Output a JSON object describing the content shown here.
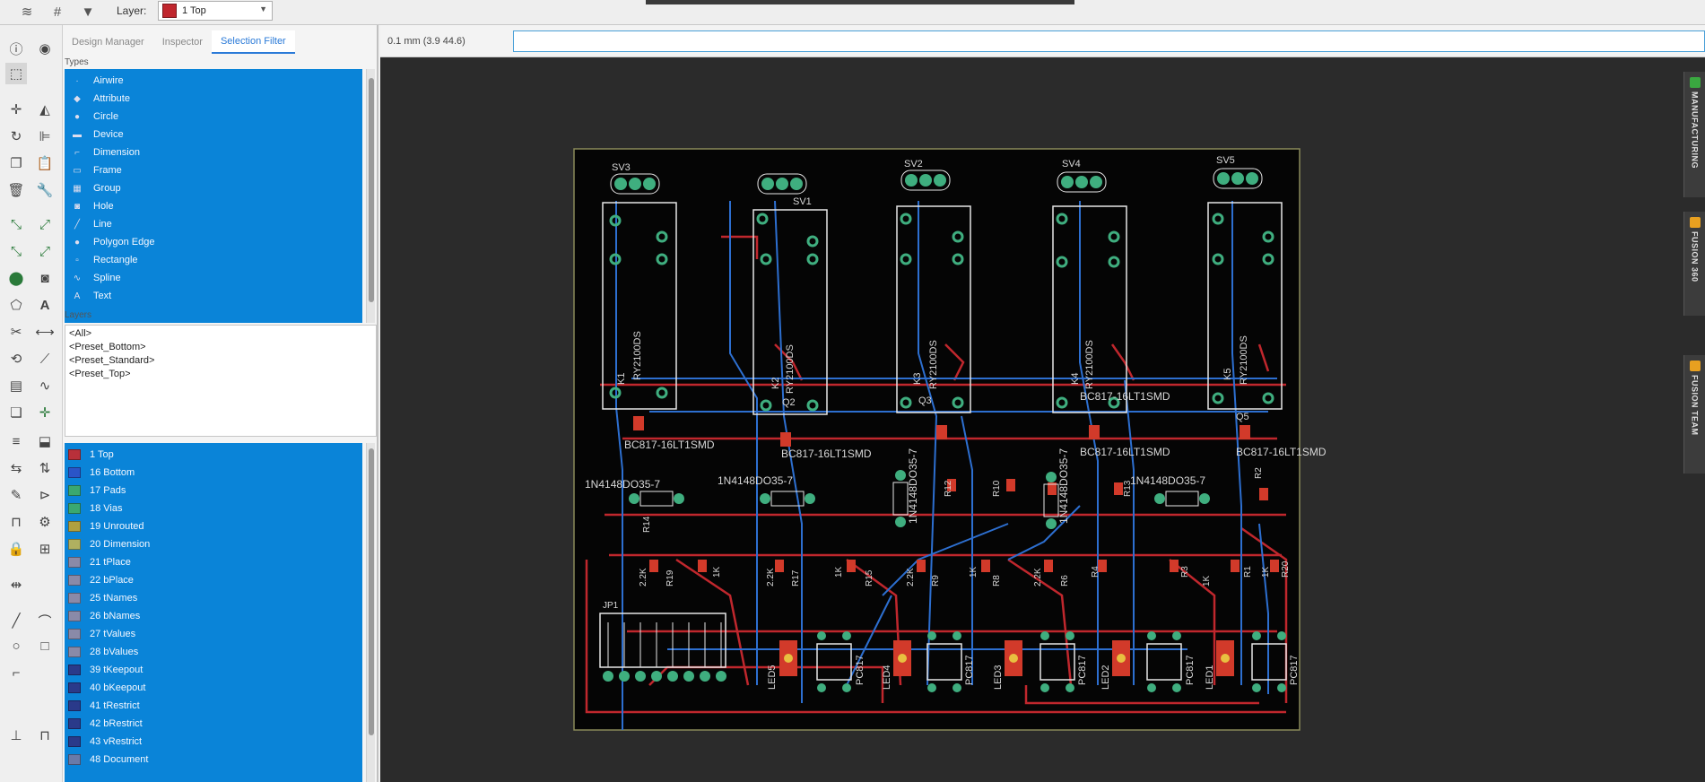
{
  "toolbar": {
    "layer_label": "Layer:",
    "layer_value": "1 Top",
    "layer_color": "#c0262d"
  },
  "panel": {
    "tabs": [
      {
        "label": "Design Manager"
      },
      {
        "label": "Inspector"
      },
      {
        "label": "Selection Filter"
      }
    ],
    "types_label": "Types",
    "types": [
      {
        "label": "Airwire",
        "icon": "airwire-icon"
      },
      {
        "label": "Attribute",
        "icon": "tag-icon"
      },
      {
        "label": "Circle",
        "icon": "circle-icon"
      },
      {
        "label": "Device",
        "icon": "device-icon"
      },
      {
        "label": "Dimension",
        "icon": "dimension-icon"
      },
      {
        "label": "Frame",
        "icon": "frame-icon"
      },
      {
        "label": "Group",
        "icon": "group-icon"
      },
      {
        "label": "Hole",
        "icon": "hole-icon"
      },
      {
        "label": "Line",
        "icon": "line-icon"
      },
      {
        "label": "Polygon Edge",
        "icon": "polygon-icon"
      },
      {
        "label": "Rectangle",
        "icon": "rectangle-icon"
      },
      {
        "label": "Spline",
        "icon": "spline-icon"
      },
      {
        "label": "Text",
        "icon": "text-icon"
      }
    ],
    "layers_label": "Layers",
    "presets": [
      "<All>",
      "<Preset_Bottom>",
      "<Preset_Standard>",
      "<Preset_Top>"
    ],
    "layers": [
      {
        "label": "1 Top",
        "color": "#b8303a"
      },
      {
        "label": "16 Bottom",
        "color": "#2a55c8"
      },
      {
        "label": "17 Pads",
        "color": "#3aa870"
      },
      {
        "label": "18 Vias",
        "color": "#3aa870"
      },
      {
        "label": "19 Unrouted",
        "color": "#b0a040"
      },
      {
        "label": "20 Dimension",
        "color": "#b0b060"
      },
      {
        "label": "21 tPlace",
        "color": "#8a8aa8"
      },
      {
        "label": "22 bPlace",
        "color": "#8a8aa8"
      },
      {
        "label": "25 tNames",
        "color": "#8a8aa8"
      },
      {
        "label": "26 bNames",
        "color": "#8a8aa8"
      },
      {
        "label": "27 tValues",
        "color": "#8a8aa8"
      },
      {
        "label": "28 bValues",
        "color": "#8a8aa8"
      },
      {
        "label": "39 tKeepout",
        "color": "#2a3a8a"
      },
      {
        "label": "40 bKeepout",
        "color": "#2a3a8a"
      },
      {
        "label": "41 tRestrict",
        "color": "#2a3a8a"
      },
      {
        "label": "42 bRestrict",
        "color": "#2a3a8a"
      },
      {
        "label": "43 vRestrict",
        "color": "#2a3a8a"
      },
      {
        "label": "48 Document",
        "color": "#6a7aa8"
      }
    ]
  },
  "cmdbar": {
    "coord": "0.1 mm (3.9 44.6)"
  },
  "right_tabs": [
    {
      "label": "MANUFACTURING",
      "icon_color": "#3aa840"
    },
    {
      "label": "FUSION 360",
      "icon_color": "#e8a020"
    },
    {
      "label": "FUSION TEAM",
      "icon_color": "#e8a020"
    }
  ],
  "board": {
    "headers": [
      "SV3",
      "SV1",
      "SV2",
      "SV4",
      "SV5"
    ],
    "relays": [
      "K1",
      "K2",
      "K3",
      "K4",
      "K5"
    ],
    "relay_value": "RY2100DS",
    "transistor_names": [
      "Q2",
      "Q3",
      "Q5"
    ],
    "transistor_values": [
      "BC817-16LT1SMD",
      "BC817-16LT1SMD",
      "BC817-16LT1SMD",
      "BC817-16LT1SMD",
      "BC817-16LT1SMD"
    ],
    "diodes": [
      "1N4148DO35-7",
      "1N4148DO35-7",
      "1N4148DO35-7",
      "1N4148DO35-7",
      "1N4148DO35-7"
    ],
    "leds": [
      "LED5",
      "LED4",
      "LED3",
      "LED2",
      "LED1"
    ],
    "opto": [
      "PC817",
      "PC817",
      "PC817",
      "PC817",
      "PC817"
    ],
    "resistors": [
      "R19",
      "R17",
      "R15",
      "R9",
      "R8",
      "R6",
      "R4",
      "R3",
      "R1",
      "R20",
      "R2",
      "R13",
      "R10",
      "R12",
      "R14"
    ],
    "resistor_values": [
      "2.2K",
      "1K",
      "2.2K",
      "1K",
      "2.2K",
      "1K",
      "2.2K",
      "1K",
      "1K"
    ],
    "connector": "JP1"
  }
}
